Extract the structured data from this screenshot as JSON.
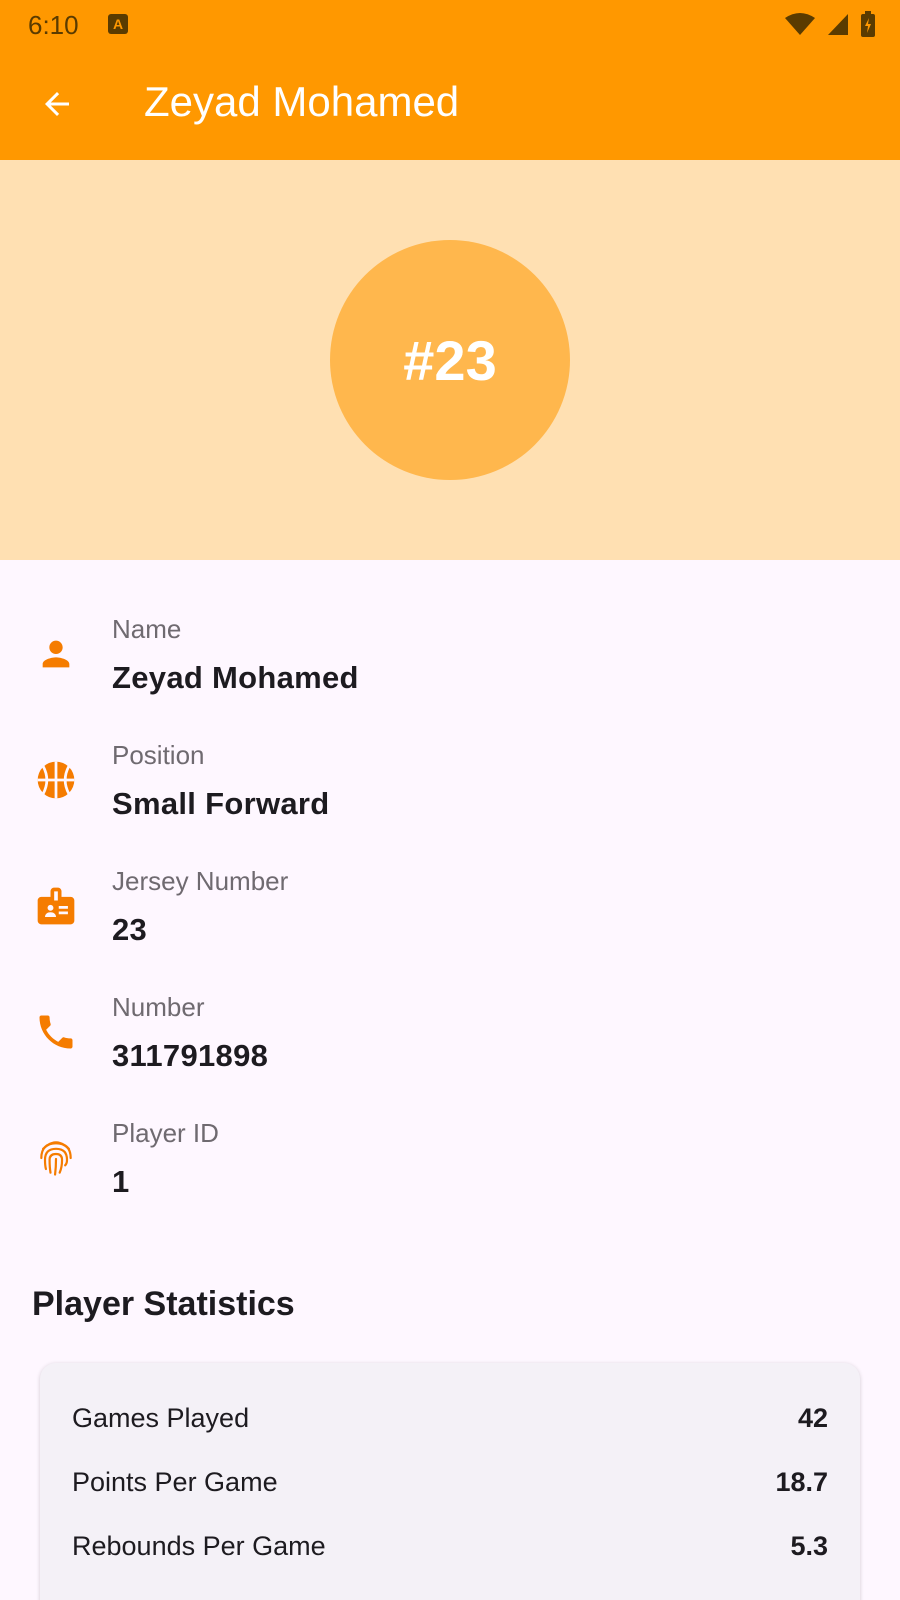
{
  "status_bar": {
    "time": "6:10",
    "app_icon_letter": "A"
  },
  "app_bar": {
    "back_icon": "arrow-back-icon",
    "title": "Zeyad Mohamed"
  },
  "header": {
    "jersey_badge": "#23",
    "colors": {
      "banner": "#FFE0B2",
      "avatar": "#FFB74D",
      "accent": "#FF9800"
    }
  },
  "details": [
    {
      "icon": "person-icon",
      "label": "Name",
      "value": "Zeyad Mohamed"
    },
    {
      "icon": "basketball-icon",
      "label": "Position",
      "value": "Small Forward"
    },
    {
      "icon": "badge-icon",
      "label": "Jersey Number",
      "value": "23"
    },
    {
      "icon": "phone-icon",
      "label": "Number",
      "value": "311791898"
    },
    {
      "icon": "fingerprint-icon",
      "label": "Player ID",
      "value": "1"
    }
  ],
  "stats": {
    "title": "Player Statistics",
    "rows": [
      {
        "label": "Games Played",
        "value": "42"
      },
      {
        "label": "Points Per Game",
        "value": "18.7"
      },
      {
        "label": "Rebounds Per Game",
        "value": "5.3"
      }
    ]
  }
}
